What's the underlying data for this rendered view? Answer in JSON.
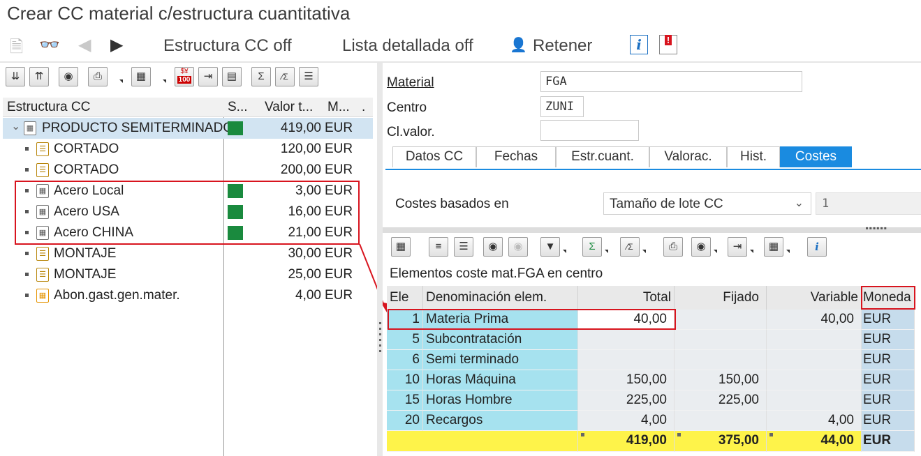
{
  "window": {
    "title": "Crear CC material c/estructura cuantitativa"
  },
  "toolbar": {
    "structure_label": "Estructura CC off",
    "detail_label": "Lista detallada off",
    "retain_label": "Retener"
  },
  "left_tree": {
    "headers": [
      "Estructura CC",
      "S...",
      "Valor t...",
      "M...",
      "."
    ],
    "rows": [
      {
        "label": "PRODUCTO SEMITERMINADO",
        "value": "419,00",
        "currency": "EUR",
        "status": true,
        "icon": "calculator-icon"
      },
      {
        "label": "CORTADO",
        "value": "120,00",
        "currency": "EUR",
        "status": false,
        "icon": "operation-icon"
      },
      {
        "label": "CORTADO",
        "value": "200,00",
        "currency": "EUR",
        "status": false,
        "icon": "operation-icon"
      },
      {
        "label": "Acero Local",
        "value": "3,00",
        "currency": "EUR",
        "status": true,
        "icon": "calculator-icon"
      },
      {
        "label": "Acero USA",
        "value": "16,00",
        "currency": "EUR",
        "status": true,
        "icon": "calculator-icon"
      },
      {
        "label": "Acero CHINA",
        "value": "21,00",
        "currency": "EUR",
        "status": true,
        "icon": "calculator-icon"
      },
      {
        "label": "MONTAJE",
        "value": "30,00",
        "currency": "EUR",
        "status": false,
        "icon": "operation-icon"
      },
      {
        "label": "MONTAJE",
        "value": "25,00",
        "currency": "EUR",
        "status": false,
        "icon": "operation-icon"
      },
      {
        "label": "Abon.gast.gen.mater.",
        "value": "4,00",
        "currency": "EUR",
        "status": false,
        "icon": "overhead-icon"
      }
    ],
    "status_color": "#1a8a3e"
  },
  "header_fields": {
    "material_label": "Material",
    "material_value": "FGA",
    "centro_label": "Centro",
    "centro_value": "ZUNI",
    "clvalor_label": "Cl.valor.",
    "clvalor_value": ""
  },
  "tabs": [
    "Datos CC",
    "Fechas",
    "Estr.cuant.",
    "Valorac.",
    "Hist.",
    "Costes"
  ],
  "active_tab": "Costes",
  "costs": {
    "basis_label": "Costes basados en",
    "basis_value": "Tamaño de lote CC",
    "lot_value": "1"
  },
  "grid": {
    "title": "Elementos coste mat.FGA en centro",
    "headers": {
      "ele": "Ele",
      "name": "Denominación elem.",
      "total": "Total",
      "fixed": "Fijado",
      "variable": "Variable",
      "currency": "Moneda"
    },
    "rows": [
      {
        "ele": "1",
        "name": "Materia Prima",
        "total": "40,00",
        "fixed": "",
        "variable": "40,00",
        "currency": "EUR"
      },
      {
        "ele": "5",
        "name": "Subcontratación",
        "total": "",
        "fixed": "",
        "variable": "",
        "currency": "EUR"
      },
      {
        "ele": "6",
        "name": "Semi terminado",
        "total": "",
        "fixed": "",
        "variable": "",
        "currency": "EUR"
      },
      {
        "ele": "10",
        "name": "Horas Máquina",
        "total": "150,00",
        "fixed": "150,00",
        "variable": "",
        "currency": "EUR"
      },
      {
        "ele": "15",
        "name": "Horas Hombre",
        "total": "225,00",
        "fixed": "225,00",
        "variable": "",
        "currency": "EUR"
      },
      {
        "ele": "20",
        "name": "Recargos",
        "total": "4,00",
        "fixed": "",
        "variable": "4,00",
        "currency": "EUR"
      }
    ],
    "totals": {
      "total": "419,00",
      "fixed": "375,00",
      "variable": "44,00",
      "currency": "EUR"
    }
  },
  "colors": {
    "accent": "#1a8be0",
    "highlight_red": "#d8141e",
    "total_row": "#fef34a",
    "key_cell": "#a6e2ef"
  }
}
